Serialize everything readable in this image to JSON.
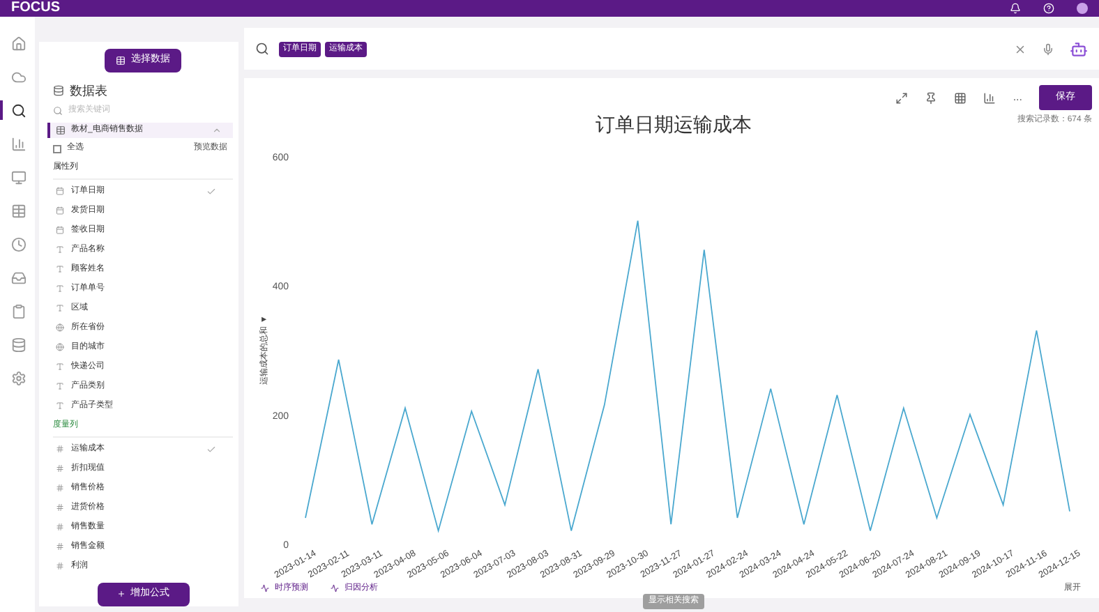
{
  "app": {
    "logo": "FOCUS"
  },
  "nav": [
    {
      "selected": false
    },
    {
      "selected": false
    },
    {
      "selected": true
    },
    {
      "selected": false
    },
    {
      "selected": false
    },
    {
      "selected": false
    },
    {
      "selected": false
    },
    {
      "selected": false
    },
    {
      "selected": false
    },
    {
      "selected": false
    },
    {
      "selected": false
    }
  ],
  "sidebar": {
    "select_button": "选择数据",
    "section_title": "数据表",
    "search": {
      "placeholder": "搜索关键词"
    },
    "table_name": "教材_电商销售数据",
    "select_all": {
      "label": "全选",
      "checked": false
    },
    "preview": "预览数据",
    "groups": [
      {
        "title": "属性列",
        "kind": "attribute",
        "items": [
          {
            "label": "订单日期",
            "kind": "date",
            "checked": true
          },
          {
            "label": "发货日期",
            "kind": "date",
            "checked": false
          },
          {
            "label": "签收日期",
            "kind": "date",
            "checked": false
          },
          {
            "label": "产品名称",
            "kind": "text",
            "checked": false
          },
          {
            "label": "顾客姓名",
            "kind": "text",
            "checked": false
          },
          {
            "label": "订单单号",
            "kind": "text",
            "checked": false
          },
          {
            "label": "区域",
            "kind": "text",
            "checked": false
          },
          {
            "label": "所在省份",
            "kind": "geo",
            "checked": false
          },
          {
            "label": "目的城市",
            "kind": "geo",
            "checked": false
          },
          {
            "label": "快递公司",
            "kind": "text",
            "checked": false
          },
          {
            "label": "产品类别",
            "kind": "text",
            "checked": false
          },
          {
            "label": "产品子类型",
            "kind": "text",
            "checked": false
          }
        ]
      },
      {
        "title": "度量列",
        "kind": "measure",
        "items": [
          {
            "label": "运输成本",
            "kind": "number",
            "checked": true
          },
          {
            "label": "折扣现值",
            "kind": "number",
            "checked": false
          },
          {
            "label": "销售价格",
            "kind": "number",
            "checked": false
          },
          {
            "label": "进货价格",
            "kind": "number",
            "checked": false
          },
          {
            "label": "销售数量",
            "kind": "number",
            "checked": false
          },
          {
            "label": "销售金额",
            "kind": "number",
            "checked": false
          },
          {
            "label": "利润",
            "kind": "number",
            "checked": false
          }
        ]
      }
    ],
    "add_formula": "增加公式"
  },
  "search_bar": {
    "tokens": [
      "订单日期",
      "运输成本"
    ]
  },
  "toolbar": {
    "save": "保存",
    "more": "..."
  },
  "chart": {
    "record_count": "搜索记录数：674 条",
    "chart_data": {
      "type": "line",
      "title": "订单日期运输成本",
      "ylabel": "运输成本的总和 ▼",
      "ylim": [
        0,
        600
      ],
      "yticks": [
        0,
        200,
        400,
        600
      ],
      "categories": [
        "2023-01-14",
        "2023-02-11",
        "2023-03-11",
        "2023-04-08",
        "2023-05-06",
        "2023-06-04",
        "2023-07-03",
        "2023-08-03",
        "2023-08-31",
        "2023-09-29",
        "2023-10-30",
        "2023-11-27",
        "2024-01-27",
        "2024-02-24",
        "2024-03-24",
        "2024-04-24",
        "2024-05-22",
        "2024-06-20",
        "2024-07-24",
        "2024-08-21",
        "2024-09-19",
        "2024-10-17",
        "2024-11-16",
        "2024-12-15"
      ],
      "series": [
        {
          "color": "#4aa8cf",
          "values": [
            40,
            285,
            30,
            210,
            20,
            205,
            60,
            270,
            20,
            215,
            500,
            30,
            455,
            40,
            240,
            30,
            230,
            20,
            210,
            40,
            200,
            60,
            330,
            50
          ]
        }
      ]
    }
  },
  "footer": {
    "actions": [
      "时序预测",
      "归因分析"
    ],
    "expand": "展开",
    "related": "显示相关搜索"
  }
}
